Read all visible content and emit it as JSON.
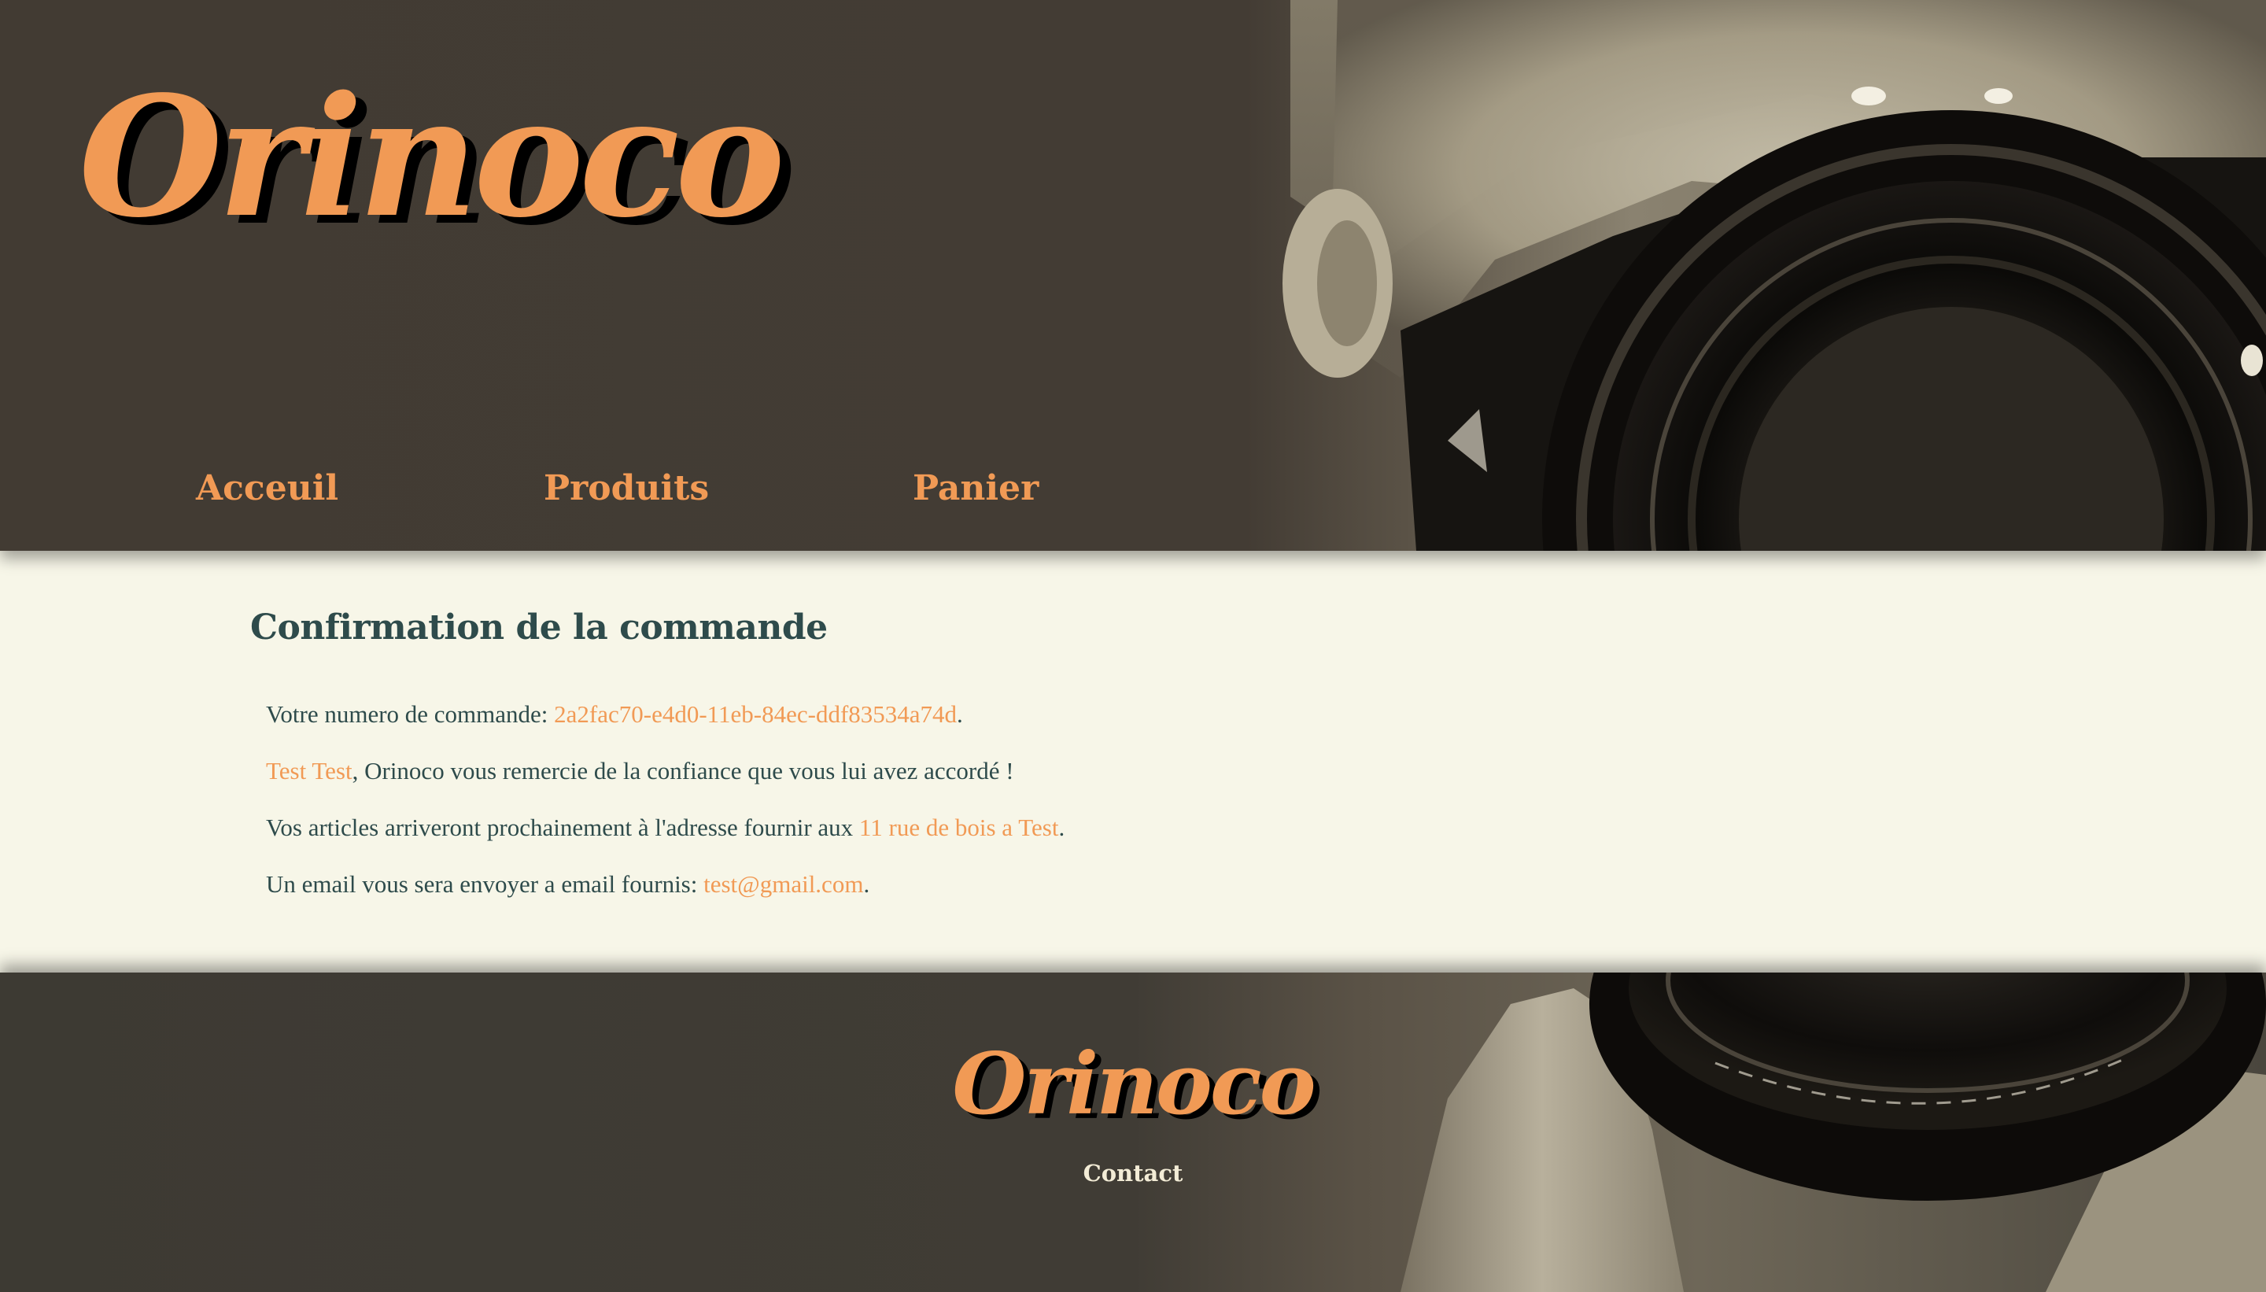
{
  "brand": {
    "name": "Orinoco",
    "accent_color": "#f19a55",
    "text_color": "#2e4b4b",
    "background_color": "#f7f6e8"
  },
  "nav": {
    "items": [
      {
        "label": "Acceuil"
      },
      {
        "label": "Produits"
      },
      {
        "label": "Panier"
      }
    ]
  },
  "confirmation": {
    "title": "Confirmation de la commande",
    "order_prefix": "Votre numero de commande: ",
    "order_id": "2a2fac70-e4d0-11eb-84ec-ddf83534a74d",
    "customer_name": "Test Test",
    "thanks_text": ", Orinoco vous remercie de la confiance que vous lui avez accordé !",
    "address_prefix": "Vos articles arriveront prochainement à l'adresse fournir aux ",
    "address": "11 rue de bois a Test",
    "email_prefix": "Un email vous sera envoyer a email fournis: ",
    "email": "test@gmail.com",
    "period": "."
  },
  "footer": {
    "brand": "Orinoco",
    "contact_label": "Contact"
  },
  "icons": {
    "header_image": "camera-photographer-photo",
    "footer_image": "camera-lens-photo"
  }
}
